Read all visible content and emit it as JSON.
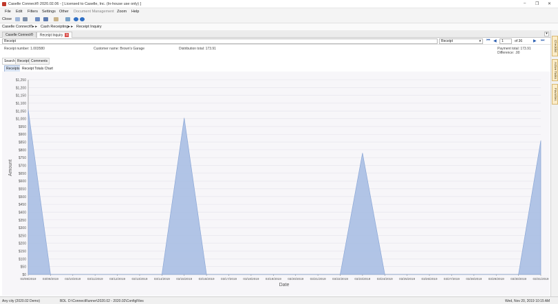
{
  "window": {
    "title": "Caselle Connect® 2020.02.06 - [ Licensed to Caselle, Inc. (In-house use only) ]",
    "min": "–",
    "max": "❐",
    "close": "✕"
  },
  "menu": {
    "file": "File",
    "edit": "Edit",
    "filters": "Filters",
    "settings": "Settings",
    "other": "Other",
    "docmgmt": "Document Management",
    "zoom": "Zoom",
    "help": "Help"
  },
  "toolbar": {
    "close_label": "Close"
  },
  "breadcrumb": {
    "root": "Caselle Connect®",
    "sep1": "▸ ▸",
    "cash": "Cash Receipting",
    "sep2": "▸ ▸",
    "page": "Receipt Inquiry"
  },
  "tabs": {
    "home": "Caselle Connect®",
    "inquiry": "Receipt Inquiry",
    "close": "x"
  },
  "search": {
    "field_value": "Receipt",
    "type_value": "Receipt",
    "page_value": "1",
    "page_of": "of 36"
  },
  "info": {
    "receipt_number": "Receipt number:  1.003580",
    "customer": "Customer name:  Brown's Garage",
    "dist_total": "Distribution total:  173.91",
    "payment_total": "Payment total:  173.91",
    "difference": "Difference:  .00"
  },
  "subtabs": {
    "search": "Search",
    "receipt": "Receipt",
    "comments": "Comments"
  },
  "innertabs": {
    "receipts": "Receipts",
    "chart": "Receipt Totals Chart"
  },
  "sidebar": {
    "checklist": "Checklist",
    "active_tasks": "Active Tasks",
    "favorites": "Favorites"
  },
  "chart_data": {
    "type": "area",
    "xlabel": "Date",
    "ylabel": "Amount",
    "ylim": [
      0,
      1250
    ],
    "yticks": [
      "$0",
      "$50",
      "$100",
      "$150",
      "$200",
      "$250",
      "$300",
      "$350",
      "$400",
      "$450",
      "$500",
      "$550",
      "$600",
      "$650",
      "$700",
      "$750",
      "$800",
      "$850",
      "$900",
      "$950",
      "$1,000",
      "$1,050",
      "$1,100",
      "$1,150",
      "$1,200",
      "$1,250"
    ],
    "categories": [
      "03/08/2019",
      "03/09/2019",
      "03/10/2019",
      "03/11/2019",
      "03/12/2019",
      "03/13/2019",
      "03/14/2019",
      "03/15/2019",
      "03/16/2019",
      "03/17/2019",
      "03/18/2019",
      "03/19/2019",
      "03/20/2019",
      "03/21/2019",
      "03/22/2019",
      "03/23/2019",
      "03/24/2019",
      "03/25/2019",
      "03/26/2019",
      "03/27/2019",
      "03/28/2019",
      "03/29/2019",
      "03/30/2019",
      "03/31/2019"
    ],
    "values": [
      1060,
      0,
      0,
      0,
      0,
      0,
      0,
      1005,
      0,
      0,
      0,
      0,
      0,
      0,
      0,
      780,
      0,
      0,
      0,
      0,
      0,
      0,
      0,
      860
    ],
    "fill": "#a9bfe3",
    "stroke": "#8ba7d6",
    "grid": true
  },
  "status": {
    "left": "Any city (2020.02 Demo)",
    "db": "BDL",
    "path": "D:\\ConnectRunner\\2020.02 - 2020.02\\ConfigFiles",
    "datetime": "Wed, Nov 20, 2019 10:15 AM"
  }
}
